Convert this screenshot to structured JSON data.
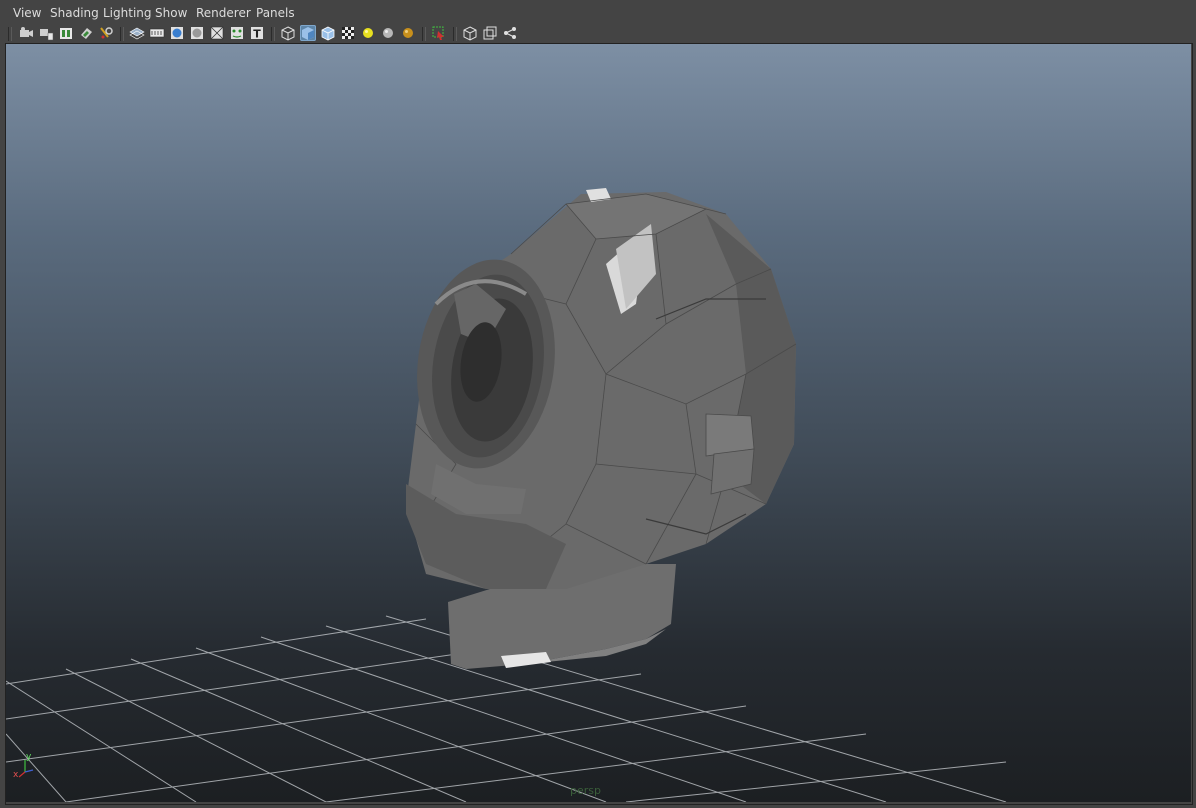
{
  "menubar": {
    "items": [
      {
        "label": "View"
      },
      {
        "label": "Shading"
      },
      {
        "label": "Lighting"
      },
      {
        "label": "Show"
      },
      {
        "label": "Renderer"
      },
      {
        "label": "Panels"
      }
    ]
  },
  "toolbar": {
    "icons": [
      "select-camera-icon",
      "camera-attributes-icon",
      "bookmarks-icon",
      "image-plane-icon",
      "camera-tools-icon",
      "grid-icon",
      "resolution-gate-icon",
      "smooth-shade-icon",
      "flat-shade-icon",
      "wireframe-icon",
      "xray-icon",
      "texture-icon",
      "default-lighting-icon",
      "smooth-shaded-active-icon",
      "wireframe-on-shaded-icon",
      "textured-icon",
      "all-lights-icon",
      "shadows-icon",
      "hardware-texture-icon",
      "isolate-select-icon",
      "single-view-icon",
      "two-view-icon",
      "hypergraph-icon"
    ]
  },
  "viewport": {
    "camera_label": "persp",
    "axis": {
      "x": "x",
      "y": "y"
    },
    "colors": {
      "bg_top": "#7d8fa4",
      "bg_bottom": "#1c1f22",
      "grid": "#b8bcc0",
      "model": "#6a6a6a",
      "x_axis": "#d03030",
      "y_axis": "#40c040"
    }
  }
}
